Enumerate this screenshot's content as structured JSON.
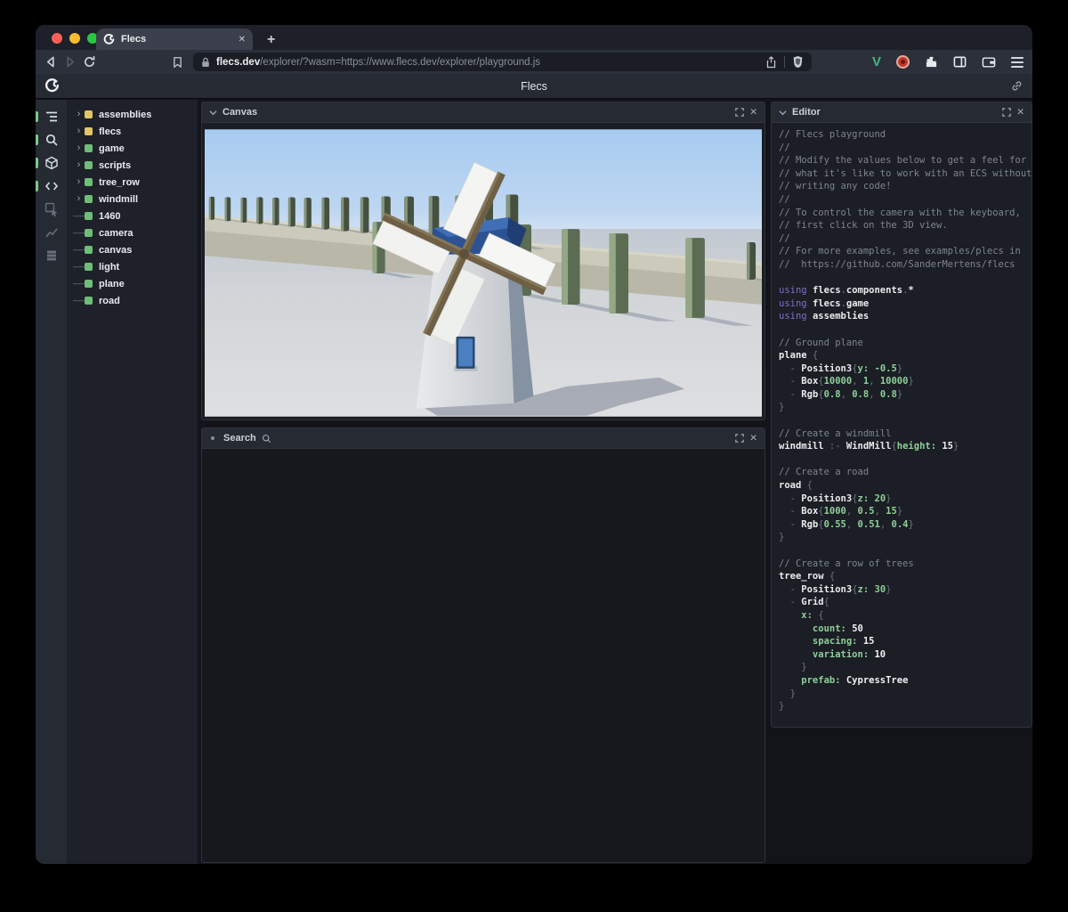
{
  "browser": {
    "tab": {
      "title": "Flecs"
    },
    "new_tab_glyph": "+",
    "address": {
      "host": "flecs.dev",
      "path": "/explorer/?wasm=https://www.flecs.dev/explorer/playground.js"
    },
    "traffic_lights": {
      "close": "#ff5f57",
      "minimize": "#febc2e",
      "zoom": "#28c840"
    }
  },
  "header": {
    "title": "Flecs"
  },
  "icons": {
    "close": "✕",
    "expand_chevron": "›",
    "leaf_dash": "——"
  },
  "sidebar": {
    "tools": [
      {
        "icon": "outline-tree-icon",
        "active": true
      },
      {
        "icon": "search-icon",
        "active": true
      },
      {
        "icon": "cube-icon",
        "active": true
      },
      {
        "icon": "code-icon",
        "active": true
      },
      {
        "icon": "inspector-icon",
        "active": false
      },
      {
        "icon": "chart-icon",
        "active": false
      },
      {
        "icon": "rows-icon",
        "active": false
      }
    ],
    "items": [
      {
        "label": "assemblies",
        "color": "#e3c566",
        "expandable": true
      },
      {
        "label": "flecs",
        "color": "#e3c566",
        "expandable": true
      },
      {
        "label": "game",
        "color": "#6fbe77",
        "expandable": true
      },
      {
        "label": "scripts",
        "color": "#6fbe77",
        "expandable": true
      },
      {
        "label": "tree_row",
        "color": "#6fbe77",
        "expandable": true
      },
      {
        "label": "windmill",
        "color": "#6fbe77",
        "expandable": true
      },
      {
        "label": "1460",
        "color": "#6fbe77",
        "expandable": false
      },
      {
        "label": "camera",
        "color": "#6fbe77",
        "expandable": false
      },
      {
        "label": "canvas",
        "color": "#6fbe77",
        "expandable": false
      },
      {
        "label": "light",
        "color": "#6fbe77",
        "expandable": false
      },
      {
        "label": "plane",
        "color": "#6fbe77",
        "expandable": false
      },
      {
        "label": "road",
        "color": "#6fbe77",
        "expandable": false
      }
    ]
  },
  "panels": {
    "canvas": {
      "title": "Canvas"
    },
    "search": {
      "title": "Search"
    },
    "editor": {
      "title": "Editor"
    }
  },
  "editor": {
    "lines": [
      [
        [
          "c",
          "// Flecs playground"
        ]
      ],
      [
        [
          "c",
          "//"
        ]
      ],
      [
        [
          "c",
          "// Modify the values below to get a feel for"
        ]
      ],
      [
        [
          "c",
          "// what it's like to work with an ECS without"
        ]
      ],
      [
        [
          "c",
          "// writing any code!"
        ]
      ],
      [
        [
          "c",
          "//"
        ]
      ],
      [
        [
          "c",
          "// To control the camera with the keyboard,"
        ]
      ],
      [
        [
          "c",
          "// first click on the 3D view."
        ]
      ],
      [
        [
          "c",
          "//"
        ]
      ],
      [
        [
          "c",
          "// For more examples, see examples/plecs in"
        ]
      ],
      [
        [
          "c",
          "//  https://github.com/SanderMertens/flecs"
        ]
      ],
      [],
      [
        [
          "k",
          "using "
        ],
        [
          "i",
          "flecs"
        ],
        [
          "p",
          "."
        ],
        [
          "i",
          "components"
        ],
        [
          "p",
          "."
        ],
        [
          "i",
          "*"
        ]
      ],
      [
        [
          "k",
          "using "
        ],
        [
          "i",
          "flecs"
        ],
        [
          "p",
          "."
        ],
        [
          "i",
          "game"
        ]
      ],
      [
        [
          "k",
          "using "
        ],
        [
          "i",
          "assemblies"
        ]
      ],
      [],
      [
        [
          "c",
          "// Ground plane"
        ]
      ],
      [
        [
          "i",
          "plane"
        ],
        [
          "p",
          " {"
        ]
      ],
      [
        [
          "p",
          "  - "
        ],
        [
          "i",
          "Position3"
        ],
        [
          "p",
          "{"
        ],
        [
          "g",
          "y: -0.5"
        ],
        [
          "p",
          "}"
        ]
      ],
      [
        [
          "p",
          "  - "
        ],
        [
          "i",
          "Box"
        ],
        [
          "p",
          "{"
        ],
        [
          "g",
          "10000"
        ],
        [
          "p",
          ", "
        ],
        [
          "g",
          "1"
        ],
        [
          "p",
          ", "
        ],
        [
          "g",
          "10000"
        ],
        [
          "p",
          "}"
        ]
      ],
      [
        [
          "p",
          "  - "
        ],
        [
          "i",
          "Rgb"
        ],
        [
          "p",
          "{"
        ],
        [
          "g",
          "0.8"
        ],
        [
          "p",
          ", "
        ],
        [
          "g",
          "0.8"
        ],
        [
          "p",
          ", "
        ],
        [
          "g",
          "0.8"
        ],
        [
          "p",
          "}"
        ]
      ],
      [
        [
          "p",
          "}"
        ]
      ],
      [],
      [
        [
          "c",
          "// Create a windmill"
        ]
      ],
      [
        [
          "i",
          "windmill"
        ],
        [
          "p",
          " :- "
        ],
        [
          "i",
          "WindMill"
        ],
        [
          "p",
          "{"
        ],
        [
          "g",
          "height: "
        ],
        [
          "w",
          "15"
        ],
        [
          "p",
          "}"
        ]
      ],
      [],
      [
        [
          "c",
          "// Create a road"
        ]
      ],
      [
        [
          "i",
          "road"
        ],
        [
          "p",
          " {"
        ]
      ],
      [
        [
          "p",
          "  - "
        ],
        [
          "i",
          "Position3"
        ],
        [
          "p",
          "{"
        ],
        [
          "g",
          "z: 20"
        ],
        [
          "p",
          "}"
        ]
      ],
      [
        [
          "p",
          "  - "
        ],
        [
          "i",
          "Box"
        ],
        [
          "p",
          "{"
        ],
        [
          "g",
          "1000"
        ],
        [
          "p",
          ", "
        ],
        [
          "g",
          "0.5"
        ],
        [
          "p",
          ", "
        ],
        [
          "g",
          "15"
        ],
        [
          "p",
          "}"
        ]
      ],
      [
        [
          "p",
          "  - "
        ],
        [
          "i",
          "Rgb"
        ],
        [
          "p",
          "{"
        ],
        [
          "g",
          "0.55"
        ],
        [
          "p",
          ", "
        ],
        [
          "g",
          "0.51"
        ],
        [
          "p",
          ", "
        ],
        [
          "g",
          "0.4"
        ],
        [
          "p",
          "}"
        ]
      ],
      [
        [
          "p",
          "}"
        ]
      ],
      [],
      [
        [
          "c",
          "// Create a row of trees"
        ]
      ],
      [
        [
          "i",
          "tree_row"
        ],
        [
          "p",
          " {"
        ]
      ],
      [
        [
          "p",
          "  - "
        ],
        [
          "i",
          "Position3"
        ],
        [
          "p",
          "{"
        ],
        [
          "g",
          "z: 30"
        ],
        [
          "p",
          "}"
        ]
      ],
      [
        [
          "p",
          "  - "
        ],
        [
          "i",
          "Grid"
        ],
        [
          "p",
          "{"
        ]
      ],
      [
        [
          "g",
          "    x: "
        ],
        [
          "p",
          "{"
        ]
      ],
      [
        [
          "g",
          "      count: "
        ],
        [
          "w",
          "50"
        ]
      ],
      [
        [
          "g",
          "      spacing: "
        ],
        [
          "w",
          "15"
        ]
      ],
      [
        [
          "g",
          "      variation: "
        ],
        [
          "w",
          "10"
        ]
      ],
      [
        [
          "p",
          "    }"
        ]
      ],
      [
        [
          "g",
          "    prefab: "
        ],
        [
          "w",
          "CypressTree"
        ]
      ],
      [
        [
          "p",
          "  }"
        ]
      ],
      [
        [
          "p",
          "}"
        ]
      ]
    ]
  }
}
